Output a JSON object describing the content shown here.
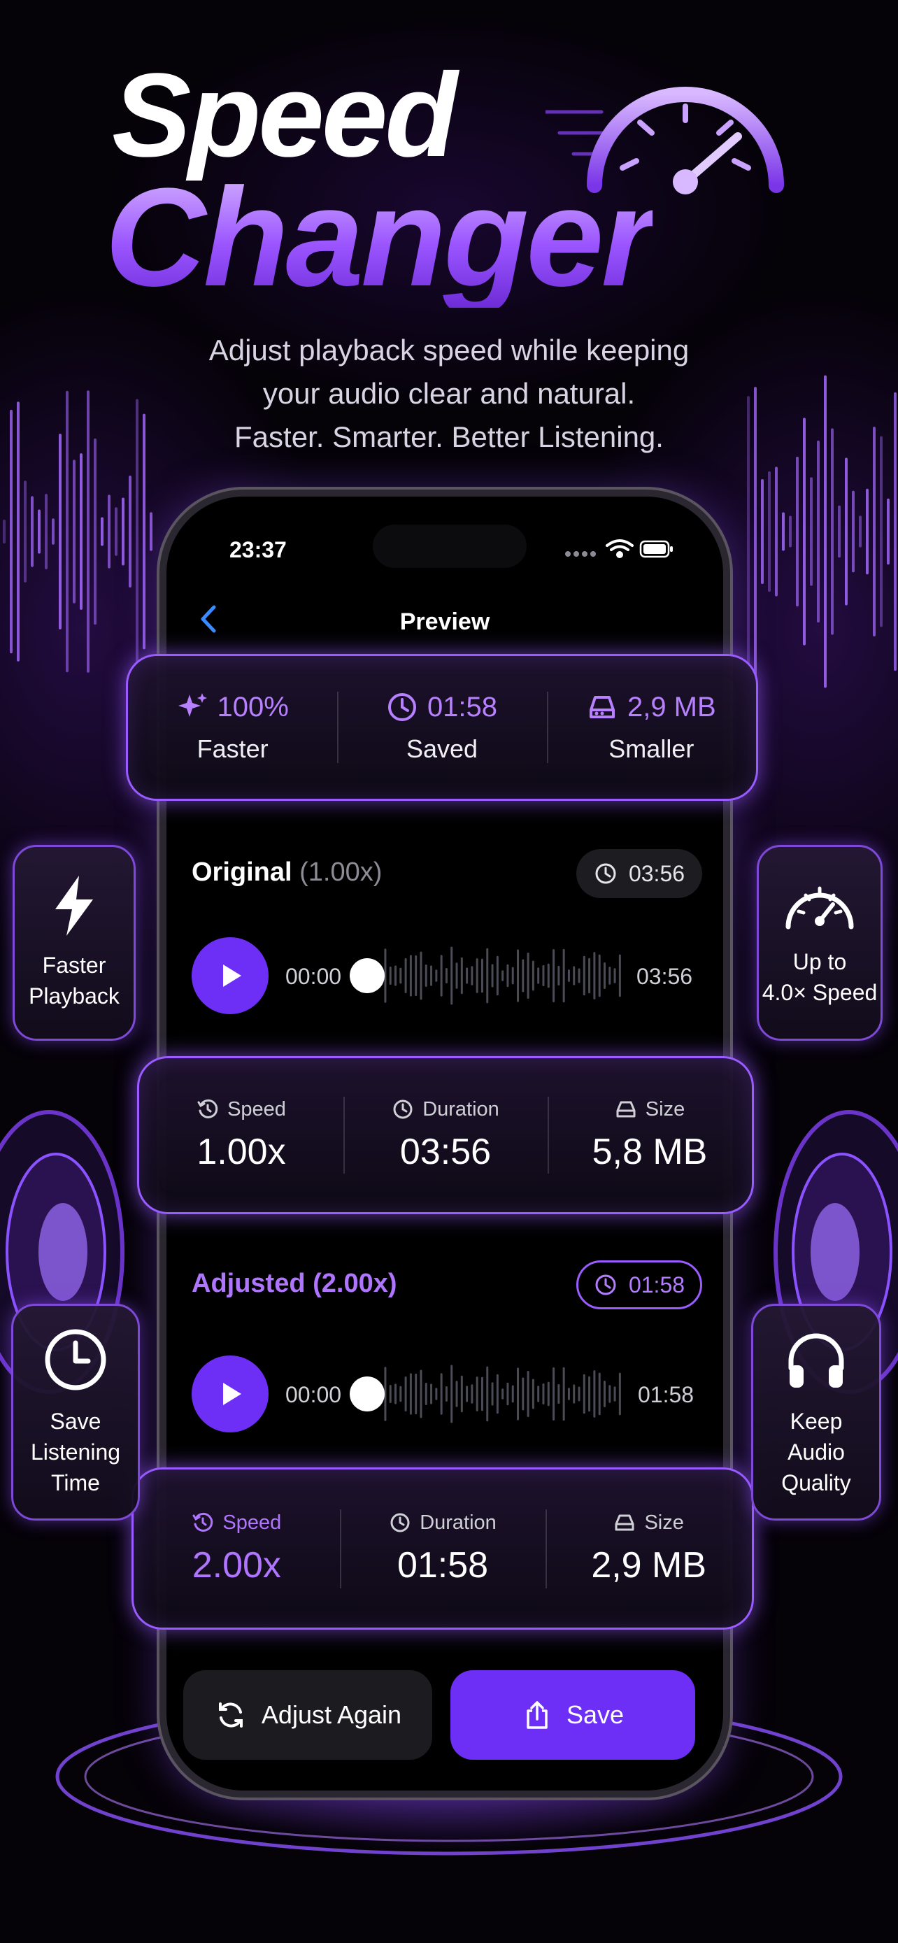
{
  "hero": {
    "title_line1": "Speed",
    "title_line2": "Changer",
    "subtitle_lines": [
      "Adjust playback speed while keeping",
      "your audio clear and natural.",
      "Faster. Smarter. Better Listening."
    ]
  },
  "status_bar": {
    "time": "23:37"
  },
  "nav": {
    "title": "Preview"
  },
  "summary": [
    {
      "icon": "sparkles-icon",
      "value": "100%",
      "label": "Faster"
    },
    {
      "icon": "clock-icon",
      "value": "01:58",
      "label": "Saved"
    },
    {
      "icon": "drive-icon",
      "value": "2,9 MB",
      "label": "Smaller"
    }
  ],
  "original": {
    "label": "Original",
    "multiplier": "(1.00x)",
    "duration_badge": "03:56",
    "current_time": "00:00",
    "end_time": "03:56",
    "progress": 0,
    "stats": [
      {
        "icon": "speed-icon",
        "label": "Speed",
        "value": "1.00x"
      },
      {
        "icon": "clock-icon",
        "label": "Duration",
        "value": "03:56"
      },
      {
        "icon": "drive-icon",
        "label": "Size",
        "value": "5,8 MB"
      }
    ]
  },
  "adjusted": {
    "label": "Adjusted (2.00x)",
    "duration_badge": "01:58",
    "current_time": "00:00",
    "end_time": "01:58",
    "progress": 0,
    "stats": [
      {
        "icon": "speed-icon",
        "label": "Speed",
        "value": "2.00x"
      },
      {
        "icon": "clock-icon",
        "label": "Duration",
        "value": "01:58"
      },
      {
        "icon": "drive-icon",
        "label": "Size",
        "value": "2,9 MB"
      }
    ]
  },
  "features": {
    "faster_playback": "Faster\nPlayback",
    "up_to_speed": "Up to\n4.0× Speed",
    "save_time": "Save\nListening\nTime",
    "keep_quality": "Keep\nAudio\nQuality"
  },
  "actions": {
    "adjust_again": "Adjust Again",
    "save": "Save"
  },
  "colors": {
    "accent": "#6D2FF5",
    "accent_light": "#B075FF",
    "background": "#050208"
  }
}
